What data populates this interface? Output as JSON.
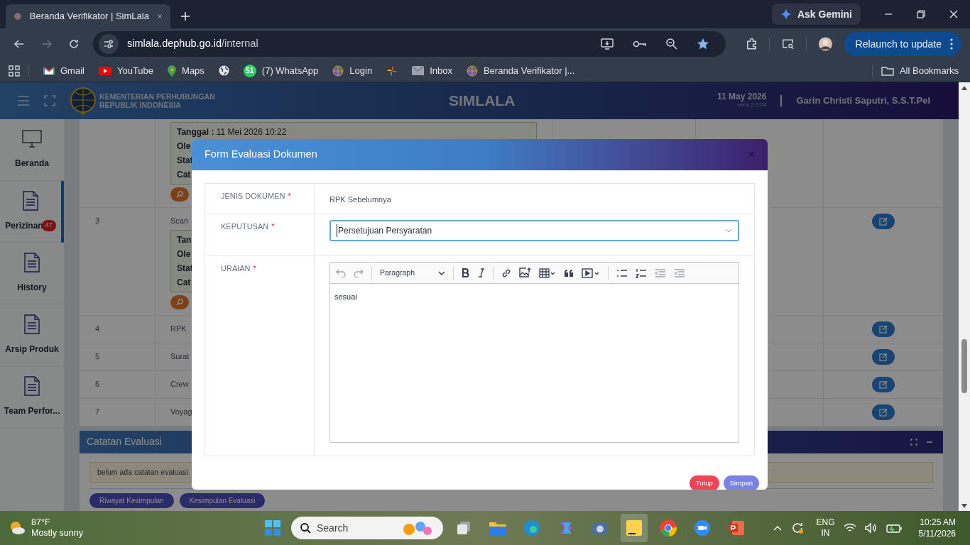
{
  "browser": {
    "tabs": [
      {
        "title": "Beranda Verifikator | SimLala",
        "selected": true
      }
    ],
    "ask_gemini": "Ask Gemini",
    "url_host": "simlala.dephub.go.id",
    "url_path": "/internal",
    "relaunch": "Relaunch to update",
    "bookmarks": [
      {
        "label": "Gmail",
        "kind": "gmail"
      },
      {
        "label": "YouTube",
        "kind": "youtube"
      },
      {
        "label": "Maps",
        "kind": "maps"
      },
      {
        "kind": "globe"
      },
      {
        "label": "(7) WhatsApp",
        "kind": "whatsapp",
        "badge": "51"
      },
      {
        "label": "Login",
        "kind": "site"
      },
      {
        "kind": "photos"
      },
      {
        "label": "Inbox",
        "kind": "mail"
      },
      {
        "label": "Beranda Verifikator |...",
        "kind": "site"
      }
    ],
    "all_bookmarks": "All Bookmarks"
  },
  "app": {
    "org_line1": "KEMENTERIAN PERHUBUNGAN",
    "org_line2": "REPUBLIK INDONESIA",
    "brand": "SIMLALA",
    "date": "11 May 2026",
    "version": "versi 2.0.24",
    "user": "Garin Christi Saputri, S.S.T.Pel"
  },
  "sidebar": {
    "items": [
      {
        "label": "Beranda",
        "selected": false
      },
      {
        "label": "Perizinan",
        "badge": "47",
        "selected": true
      },
      {
        "label": "History",
        "selected": false
      },
      {
        "label": "Arsip Produk",
        "selected": false
      },
      {
        "label": "Team Perfor...",
        "selected": false
      }
    ]
  },
  "table": {
    "rows": [
      {
        "log": [
          {
            "label": "Tanggal :",
            "value": "11 Mei 2026 10:22"
          },
          {
            "label": "Ole"
          },
          {
            "label": "Stat"
          },
          {
            "label": "Cat"
          }
        ],
        "action": false
      },
      {
        "number": "3",
        "document": "Scan",
        "log": [
          {
            "label": "Tan"
          },
          {
            "label": "Ole"
          },
          {
            "label": "Stat"
          },
          {
            "label": "Cat"
          }
        ],
        "action": true
      },
      {
        "number": "4",
        "document": "RPK",
        "action": true
      },
      {
        "number": "5",
        "document": "Surat",
        "action": true
      },
      {
        "number": "6",
        "document": "Crew",
        "action": true
      },
      {
        "number": "7",
        "document": "Voyag",
        "action": true
      }
    ]
  },
  "notes_panel": {
    "title": "Catatan Evaluasi",
    "message": "belum ada catatan evaluasi",
    "buttons": [
      "Riwayat Kesimpulan",
      "Kesimpulan Evaluasi"
    ]
  },
  "modal": {
    "title": "Form Evaluasi Dokumen",
    "close": "×",
    "fields": [
      {
        "label": "JENIS DOKUMEN",
        "required": "*",
        "kind": "text",
        "value": "RPK Sebelumnya"
      },
      {
        "label": "KEPUTUSAN",
        "required": "*",
        "kind": "select",
        "value": "Persetujuan Persyaratan"
      },
      {
        "label": "URAIAN",
        "required": "*",
        "kind": "editor",
        "block_style": "Paragraph",
        "value": "sesuai"
      }
    ],
    "buttons": [
      {
        "label": "Tutup",
        "kind": "danger"
      },
      {
        "label": "Simpan",
        "kind": "primary"
      }
    ]
  },
  "taskbar": {
    "temperature": "87°F",
    "weather": "Mostly sunny",
    "search_placeholder": "Search",
    "lang1": "ENG",
    "lang2": "IN",
    "time": "10:25 AM",
    "date": "5/11/2026"
  }
}
